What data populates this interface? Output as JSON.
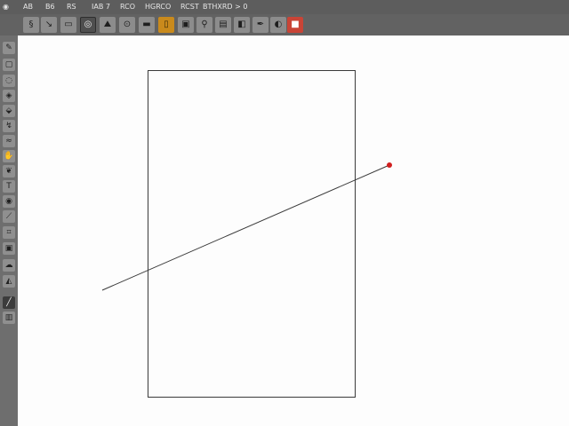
{
  "menubar": {
    "icon": "app-menu-icon",
    "items": [
      "AB",
      "B6",
      "RS",
      "IAB 7",
      "RCO",
      "HGRCO",
      "RCST",
      "BTHXRD > 0"
    ]
  },
  "toolbar": {
    "tools": [
      {
        "icon": "spiral-icon",
        "glyph": "§",
        "state": "normal"
      },
      {
        "icon": "arrow-tool-icon",
        "glyph": "↘",
        "state": "normal"
      },
      {
        "icon": "page-icon",
        "glyph": "▭",
        "state": "normal"
      },
      {
        "icon": "target-icon",
        "glyph": "◎",
        "state": "active"
      },
      {
        "icon": "image-icon",
        "glyph": "⛰",
        "state": "normal"
      },
      {
        "icon": "circle-point-icon",
        "glyph": "⊙",
        "state": "normal"
      },
      {
        "icon": "line-icon",
        "glyph": "▬",
        "state": "normal"
      },
      {
        "icon": "frame-icon",
        "glyph": "▯",
        "state": "orange"
      },
      {
        "icon": "folder-icon",
        "glyph": "▣",
        "state": "normal"
      },
      {
        "icon": "link-icon",
        "glyph": "⚲",
        "state": "normal"
      },
      {
        "icon": "document-icon",
        "glyph": "▤",
        "state": "normal"
      },
      {
        "icon": "stack-icon",
        "glyph": "◧",
        "state": "normal"
      },
      {
        "icon": "pen-tool-icon",
        "glyph": "✒",
        "state": "normal"
      },
      {
        "icon": "capture-icon",
        "glyph": "◐",
        "state": "normal"
      },
      {
        "icon": "stop-icon",
        "glyph": "■",
        "state": "red"
      }
    ]
  },
  "sidebar": {
    "tools": [
      {
        "icon": "pencil-icon",
        "glyph": "✎",
        "state": "normal"
      },
      {
        "icon": "square-select-icon",
        "glyph": "▢",
        "state": "normal"
      },
      {
        "icon": "lasso-icon",
        "glyph": "◌",
        "state": "normal"
      },
      {
        "icon": "eraser-icon",
        "glyph": "◈",
        "state": "normal"
      },
      {
        "icon": "bucket-icon",
        "glyph": "⬙",
        "state": "normal"
      },
      {
        "icon": "curve-icon",
        "glyph": "↯",
        "state": "normal"
      },
      {
        "icon": "brush-icon",
        "glyph": "≈",
        "state": "normal"
      },
      {
        "icon": "hand-icon",
        "glyph": "✋",
        "state": "normal"
      },
      {
        "icon": "drop-icon",
        "glyph": "❦",
        "state": "normal"
      },
      {
        "icon": "text-icon",
        "glyph": "T",
        "state": "normal"
      },
      {
        "icon": "node-icon",
        "glyph": "◉",
        "state": "normal"
      },
      {
        "icon": "knife-icon",
        "glyph": "⟋",
        "state": "normal"
      },
      {
        "icon": "crop-icon",
        "glyph": "⌗",
        "state": "normal"
      },
      {
        "icon": "frame-tool-icon",
        "glyph": "▣",
        "state": "normal"
      },
      {
        "icon": "cloud-icon",
        "glyph": "☁",
        "state": "normal"
      },
      {
        "icon": "gradient-icon",
        "glyph": "◭",
        "state": "normal"
      },
      {
        "icon": "line-tool-icon",
        "glyph": "╱",
        "state": "dark"
      },
      {
        "icon": "paper-icon",
        "glyph": "▥",
        "state": "normal"
      }
    ]
  },
  "colors": {
    "line": "#3a3a3a",
    "endpoint": "#d11f1f"
  }
}
